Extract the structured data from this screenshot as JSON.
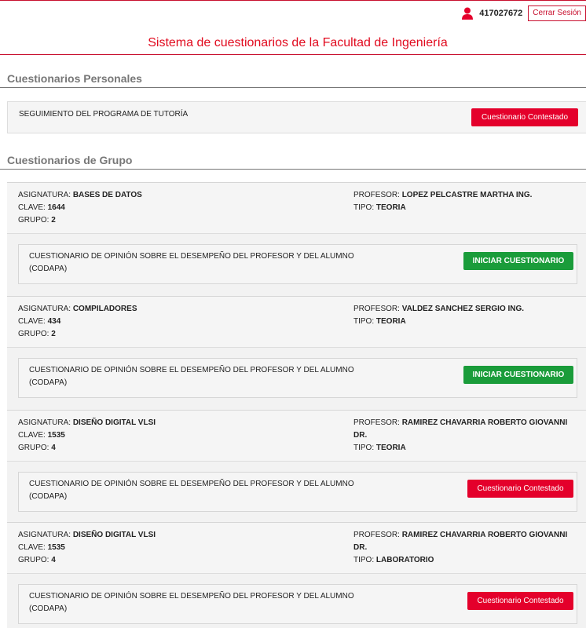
{
  "header": {
    "user_id": "417027672",
    "logout_label": "Cerrar Sesión",
    "title": "Sistema de cuestionarios de la Facultad de Ingeniería",
    "accent_color": "#c8102e"
  },
  "personal": {
    "heading": "Cuestionarios Personales",
    "items": [
      {
        "name": "SEGUIMIENTO DEL PROGRAMA DE TUTORÍA",
        "button": "Cuestionario Contestado"
      }
    ]
  },
  "group": {
    "heading": "Cuestionarios de Grupo",
    "labels": {
      "asignatura": "ASIGNATURA:",
      "clave": "CLAVE:",
      "grupo": "GRUPO:",
      "profesor": "PROFESOR:",
      "tipo": "TIPO:"
    },
    "courses": [
      {
        "asignatura": "BASES DE DATOS",
        "clave": "1644",
        "grupo": "2",
        "profesor": "LOPEZ PELCASTRE MARTHA ING.",
        "tipo": "TEORIA",
        "questionnaire": "CUESTIONARIO DE OPINIÓN SOBRE EL DESEMPEÑO DEL PROFESOR Y DEL ALUMNO (CODAPA)",
        "button": "INICIAR CUESTIONARIO",
        "status": "start"
      },
      {
        "asignatura": "COMPILADORES",
        "clave": "434",
        "grupo": "2",
        "profesor": "VALDEZ SANCHEZ SERGIO ING.",
        "tipo": "TEORIA",
        "questionnaire": "CUESTIONARIO DE OPINIÓN SOBRE EL DESEMPEÑO DEL PROFESOR Y DEL ALUMNO (CODAPA)",
        "button": "INICIAR CUESTIONARIO",
        "status": "start"
      },
      {
        "asignatura": "DISEÑO DIGITAL VLSI",
        "clave": "1535",
        "grupo": "4",
        "profesor": "RAMIREZ CHAVARRIA ROBERTO GIOVANNI DR.",
        "tipo": "TEORIA",
        "questionnaire": "CUESTIONARIO DE OPINIÓN SOBRE EL DESEMPEÑO DEL PROFESOR Y DEL ALUMNO (CODAPA)",
        "button": "Cuestionario Contestado",
        "status": "done"
      },
      {
        "asignatura": "DISEÑO DIGITAL VLSI",
        "clave": "1535",
        "grupo": "4",
        "profesor": "RAMIREZ CHAVARRIA ROBERTO GIOVANNI DR.",
        "tipo": "LABORATORIO",
        "questionnaire": "CUESTIONARIO DE OPINIÓN SOBRE EL DESEMPEÑO DEL PROFESOR Y DEL ALUMNO (CODAPA)",
        "button": "Cuestionario Contestado",
        "status": "done"
      }
    ]
  }
}
